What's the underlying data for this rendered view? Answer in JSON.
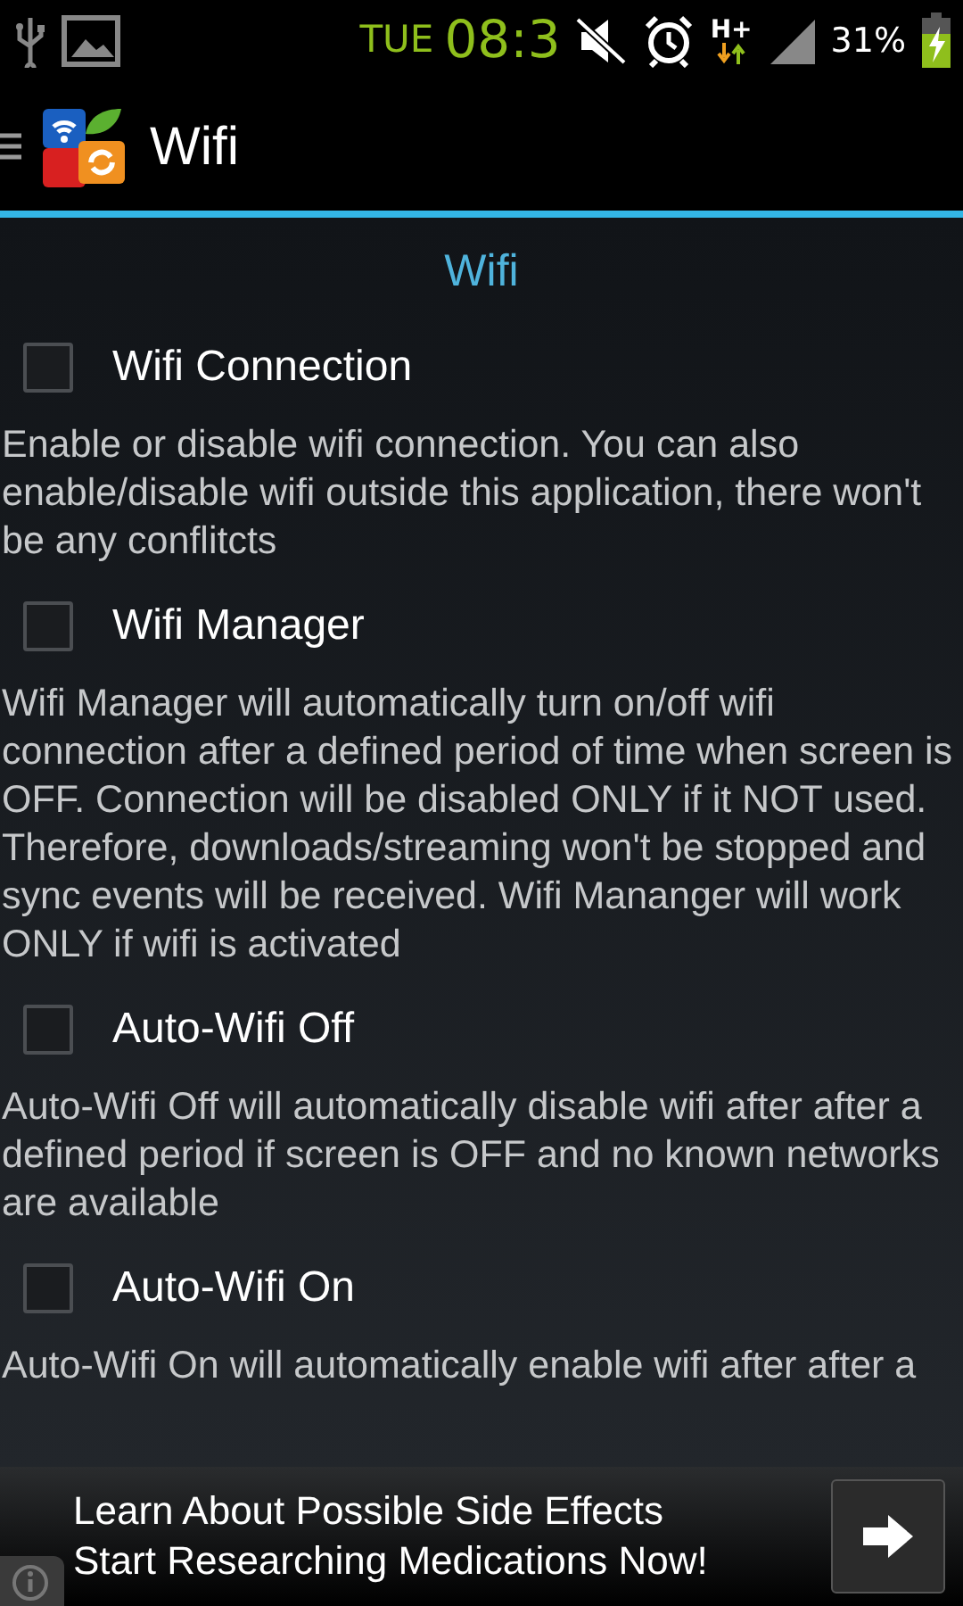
{
  "status_bar": {
    "day": "TUE",
    "time": "08:3",
    "network": "H+",
    "battery": "31%"
  },
  "action_bar": {
    "title": "Wifi"
  },
  "section_title": "Wifi",
  "settings": [
    {
      "title": "Wifi Connection",
      "checked": false,
      "description": "Enable or disable wifi connection. You can also enable/disable wifi outside this application, there won't be any conflitcts"
    },
    {
      "title": "Wifi Manager",
      "checked": false,
      "description": "Wifi Manager will automatically turn on/off wifi connection after a defined period of time when screen is OFF. Connection will be disabled ONLY if it NOT used. Therefore, downloads/streaming won't be stopped and sync events will be received. Wifi Mananger will work ONLY if wifi is activated"
    },
    {
      "title": "Auto-Wifi Off",
      "checked": false,
      "description": "Auto-Wifi Off will automatically disable wifi after after a defined period if screen is OFF and no known networks are available"
    },
    {
      "title": "Auto-Wifi On",
      "checked": false,
      "description": "Auto-Wifi On will automatically enable wifi after after a"
    }
  ],
  "ad": {
    "lines": [
      "Learn About Possible Side Effects",
      "Start Researching Medications Now!"
    ]
  }
}
